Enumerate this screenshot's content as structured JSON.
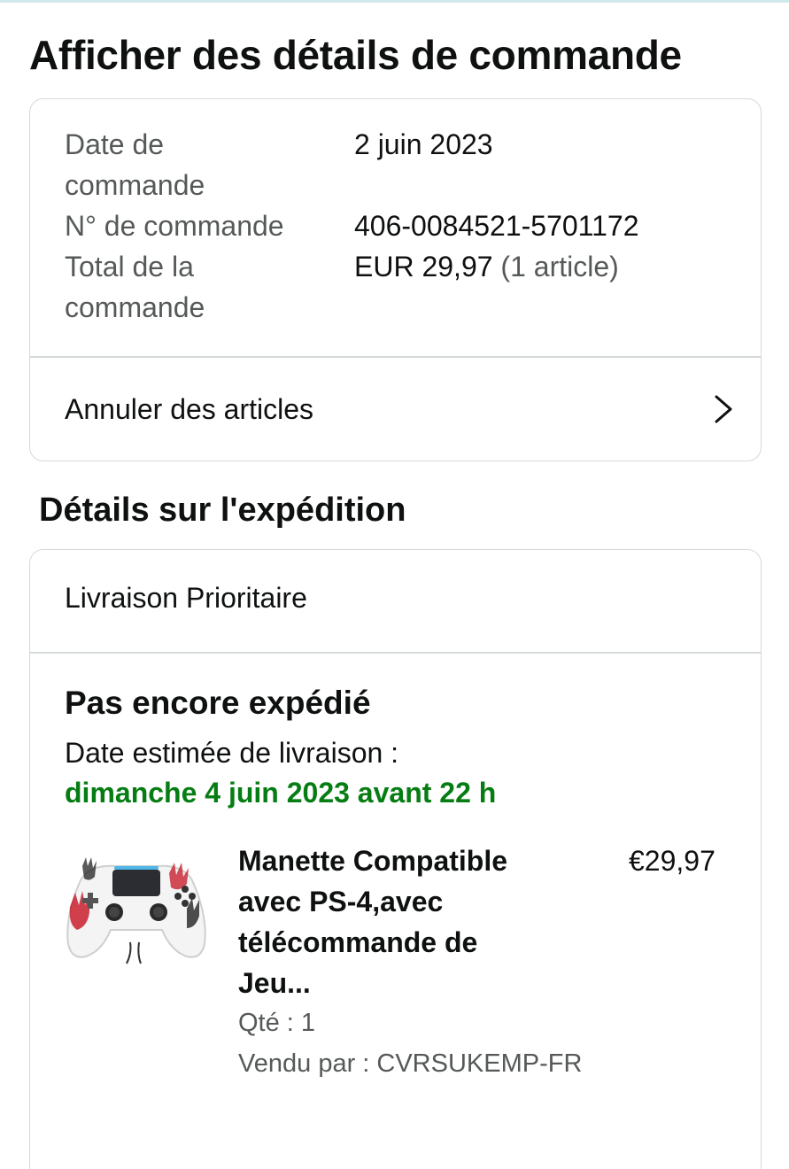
{
  "page": {
    "title": "Afficher des détails de commande"
  },
  "order_summary": {
    "rows": [
      {
        "label": "Date de commande",
        "value": "2 juin 2023"
      },
      {
        "label": "N° de commande",
        "value": "406-0084521-5701172"
      },
      {
        "label": "Total de la commande",
        "value": "EUR 29,97",
        "value_note": "(1 article)"
      }
    ],
    "cancel_label": "Annuler des articles",
    "cancel_icon": "chevron-right-icon"
  },
  "shipment": {
    "section_title": "Détails sur l'expédition",
    "method": "Livraison Prioritaire",
    "status": "Pas encore expédié",
    "eta_label": "Date estimée de livraison :",
    "eta_date": "dimanche 4 juin 2023 avant 22 h",
    "eta_color": "#067d13",
    "item": {
      "image_icon": "game-controller-image",
      "title": "Manette Compatible avec PS-4,avec télécommande de Jeu...",
      "price": "€29,97",
      "quantity": "Qté : 1",
      "seller": "Vendu par : CVRSUKEMP-FR"
    }
  }
}
